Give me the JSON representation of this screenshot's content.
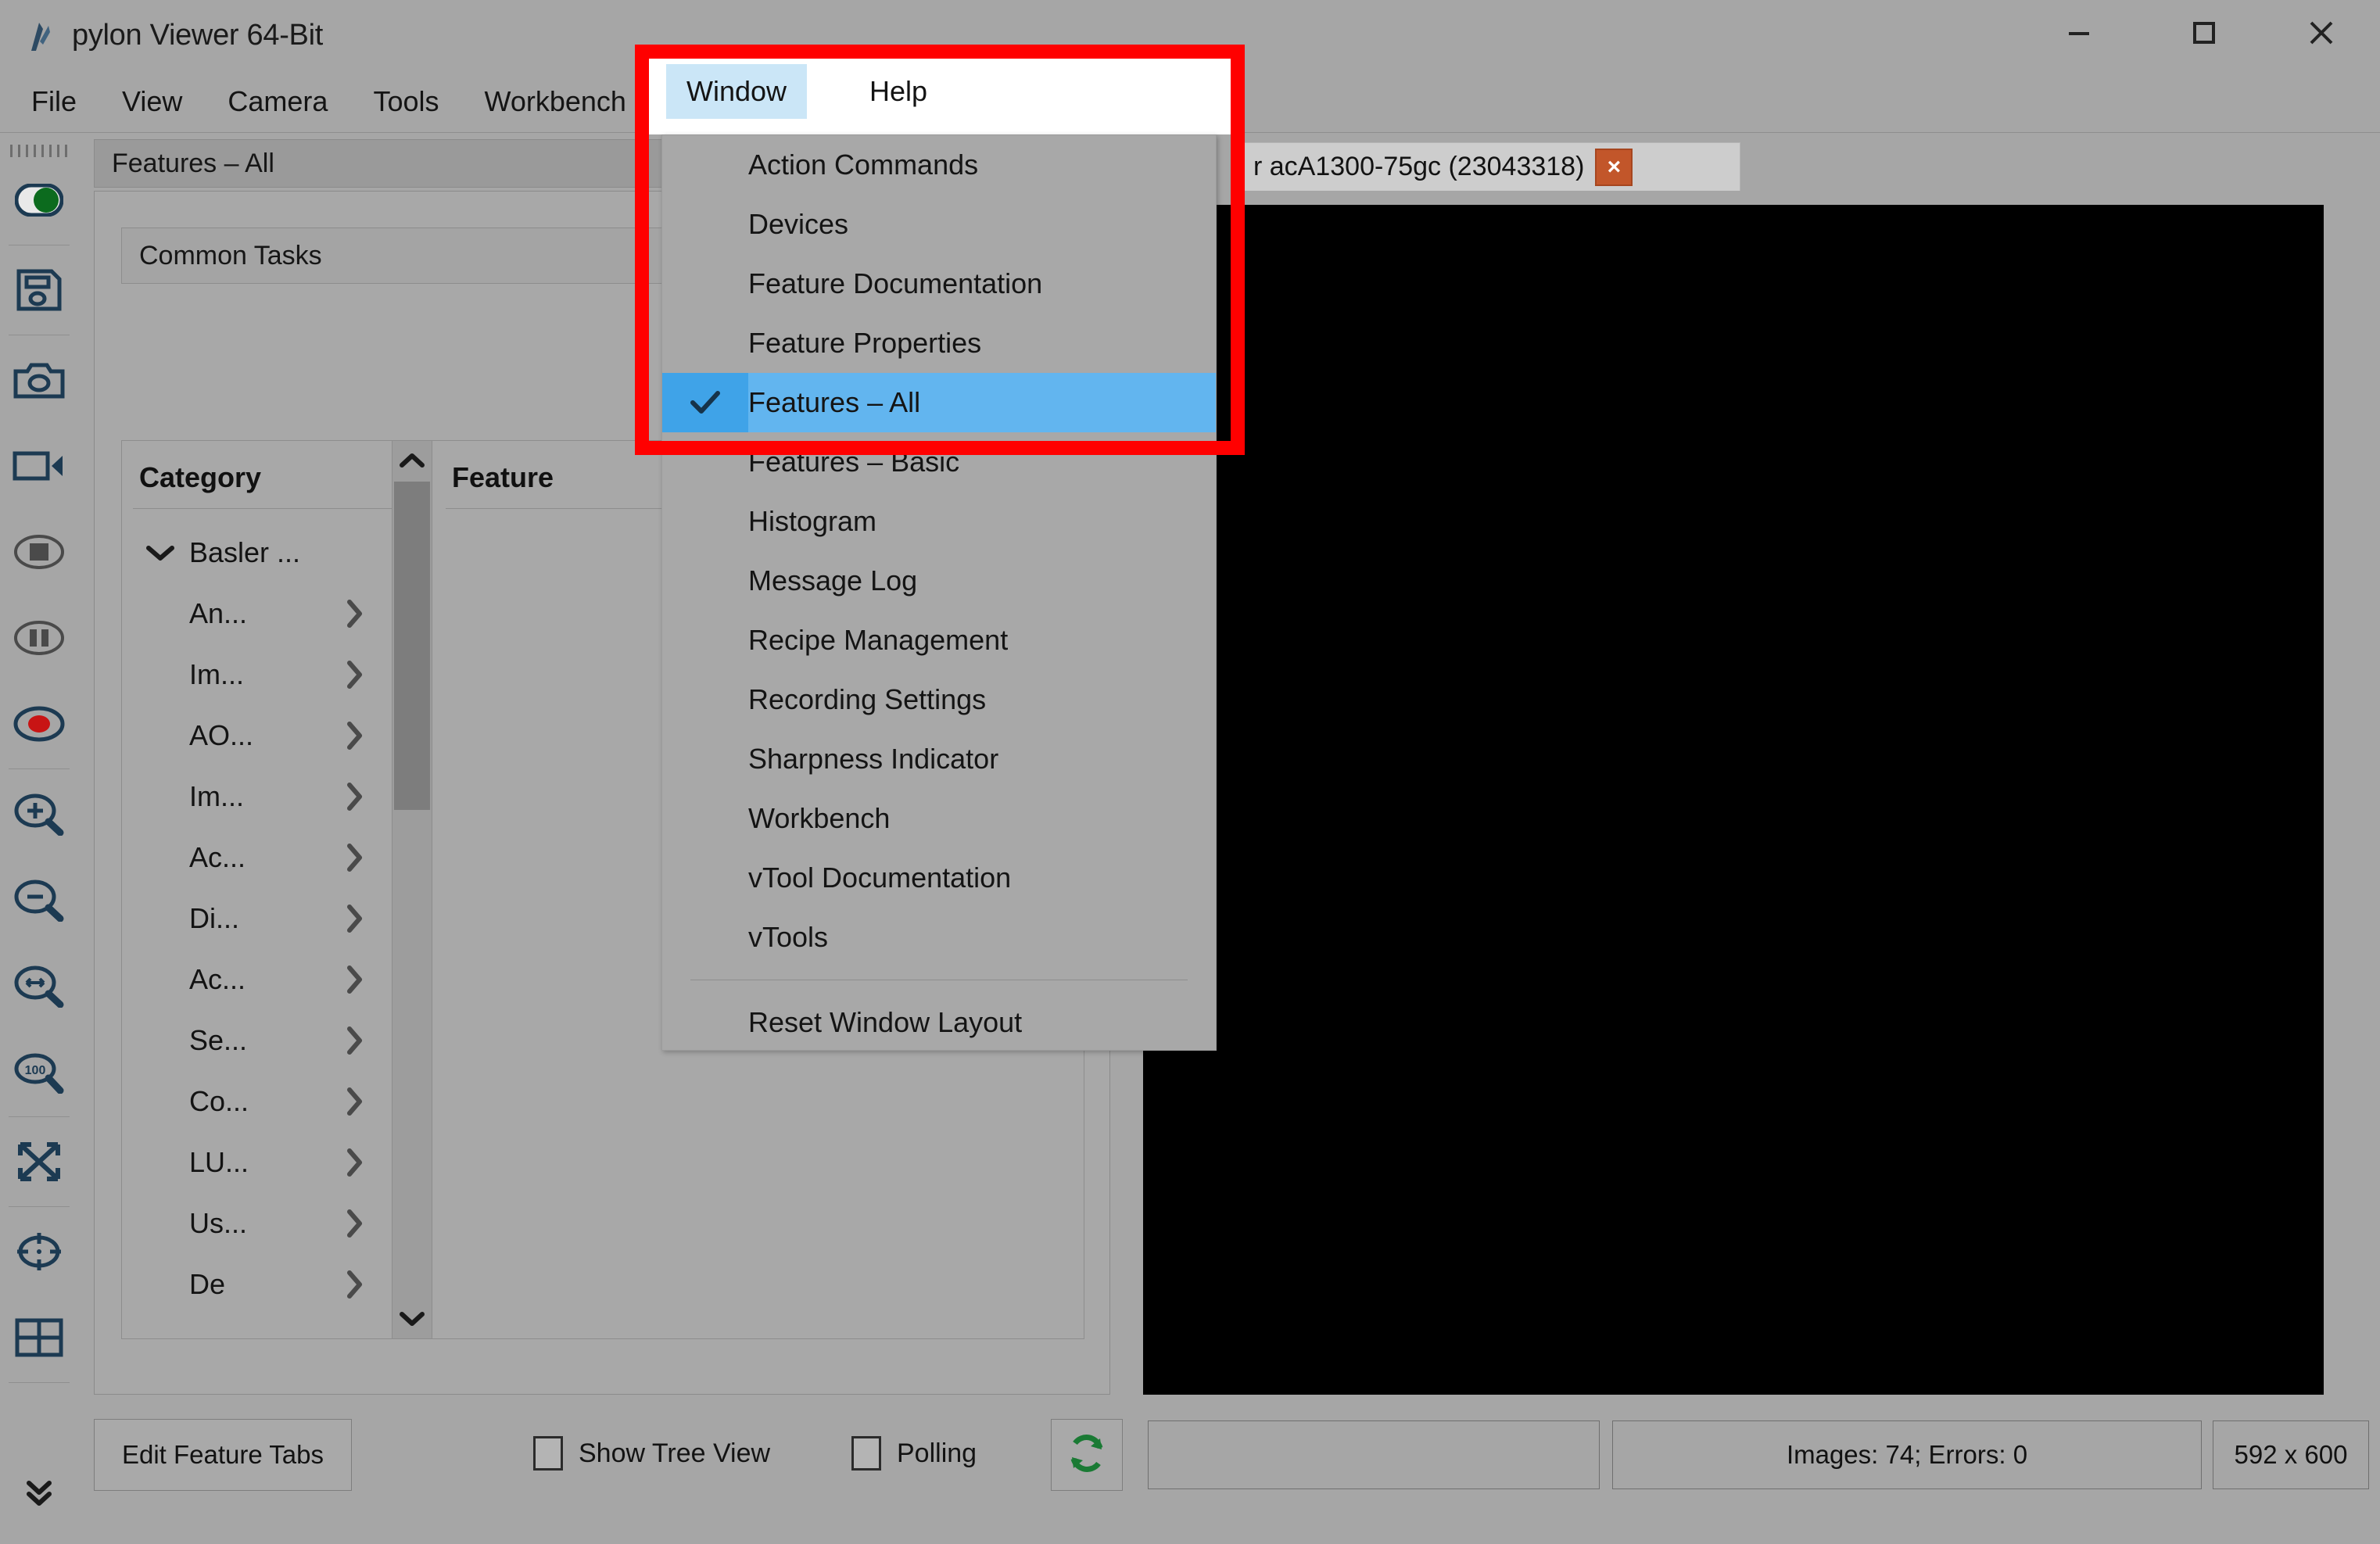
{
  "window": {
    "title": "pylon Viewer 64-Bit",
    "app_icon": "pylon-logo-icon",
    "controls": {
      "minimize": "minimize-icon",
      "maximize": "maximize-icon",
      "close": "close-icon"
    }
  },
  "menubar": {
    "items": [
      {
        "label": "File",
        "highlighted": false
      },
      {
        "label": "View",
        "highlighted": false
      },
      {
        "label": "Camera",
        "highlighted": false
      },
      {
        "label": "Tools",
        "highlighted": false
      },
      {
        "label": "Workbench",
        "highlighted": false
      },
      {
        "label": "Window",
        "highlighted": true
      },
      {
        "label": "Help",
        "highlighted": false
      }
    ]
  },
  "window_menu": {
    "highlight_color": "#62b5ef",
    "items": [
      {
        "label": "Action Commands",
        "checked": false
      },
      {
        "label": "Devices",
        "checked": false
      },
      {
        "label": "Feature Documentation",
        "checked": false
      },
      {
        "label": "Feature Properties",
        "checked": false
      },
      {
        "label": "Features – All",
        "checked": true
      },
      {
        "label": "Features – Basic",
        "checked": false
      },
      {
        "label": "Histogram",
        "checked": false
      },
      {
        "label": "Message Log",
        "checked": false
      },
      {
        "label": "Recipe Management",
        "checked": false
      },
      {
        "label": "Recording Settings",
        "checked": false
      },
      {
        "label": "Sharpness Indicator",
        "checked": false
      },
      {
        "label": "Workbench",
        "checked": false
      },
      {
        "label": "vTool Documentation",
        "checked": false
      },
      {
        "label": "vTools",
        "checked": false
      }
    ],
    "footer_item": "Reset Window Layout"
  },
  "left_toolbar": {
    "grip": "drag-grip-handle",
    "buttons": [
      {
        "name": "toggle-continuous-shot-icon"
      },
      {
        "name": "save-image-icon"
      },
      {
        "name": "single-shot-camera-icon"
      },
      {
        "name": "continuous-shot-video-icon"
      },
      {
        "name": "stop-icon"
      },
      {
        "name": "pause-icon"
      },
      {
        "name": "record-icon"
      },
      {
        "name": "zoom-in-icon"
      },
      {
        "name": "zoom-out-icon"
      },
      {
        "name": "zoom-fit-width-icon"
      },
      {
        "name": "zoom-100-icon"
      },
      {
        "name": "fit-to-window-icon"
      },
      {
        "name": "center-crosshair-icon"
      },
      {
        "name": "grid-overlay-icon"
      }
    ],
    "overflow": "more-tools-chevron-icon"
  },
  "features_panel": {
    "tab_label": "Features – All",
    "common_tasks_label": "Common Tasks",
    "columns": {
      "category": "Category",
      "feature": "Feature"
    },
    "tree": [
      {
        "label": "Basler ...",
        "expanded": true,
        "has_children": true,
        "level": 0
      },
      {
        "label": "An...",
        "expanded": false,
        "has_children": true,
        "level": 1
      },
      {
        "label": "Im...",
        "expanded": false,
        "has_children": true,
        "level": 1
      },
      {
        "label": "AO...",
        "expanded": false,
        "has_children": true,
        "level": 1
      },
      {
        "label": "Im...",
        "expanded": false,
        "has_children": true,
        "level": 1
      },
      {
        "label": "Ac...",
        "expanded": false,
        "has_children": true,
        "level": 1
      },
      {
        "label": "Di...",
        "expanded": false,
        "has_children": true,
        "level": 1
      },
      {
        "label": "Ac...",
        "expanded": false,
        "has_children": true,
        "level": 1
      },
      {
        "label": "Se...",
        "expanded": false,
        "has_children": true,
        "level": 1
      },
      {
        "label": "Co...",
        "expanded": false,
        "has_children": true,
        "level": 1
      },
      {
        "label": "LU...",
        "expanded": false,
        "has_children": true,
        "level": 1
      },
      {
        "label": "Us...",
        "expanded": false,
        "has_children": true,
        "level": 1
      },
      {
        "label": "De",
        "expanded": false,
        "has_children": true,
        "level": 1
      }
    ],
    "scrollbar": {
      "up_arrow": "chevron-up-icon",
      "down_arrow": "chevron-down-icon"
    }
  },
  "bottom_bar": {
    "edit_feature_tabs": "Edit Feature Tabs",
    "show_tree_view": {
      "label": "Show Tree View",
      "checked": false
    },
    "polling": {
      "label": "Polling",
      "checked": false
    },
    "refresh_icon": "refresh-icon",
    "status_blank": "",
    "status_images": "Images: 74; Errors: 0",
    "status_size": "592 x 600"
  },
  "camera_tab": {
    "label": "r acA1300-75gc (23043318)",
    "close_glyph": "×"
  },
  "colors": {
    "window_bg": "#a6a6a6",
    "menu_highlight": "#cbe6f7",
    "selected_item": "#62b5ef",
    "annotation_red": "#ff0000",
    "image_view": "#000000",
    "refresh_green": "#1a7a34",
    "record_red": "#c81414",
    "toggle_green": "#0c6b1e",
    "tab_close_orange": "#c2562a"
  }
}
